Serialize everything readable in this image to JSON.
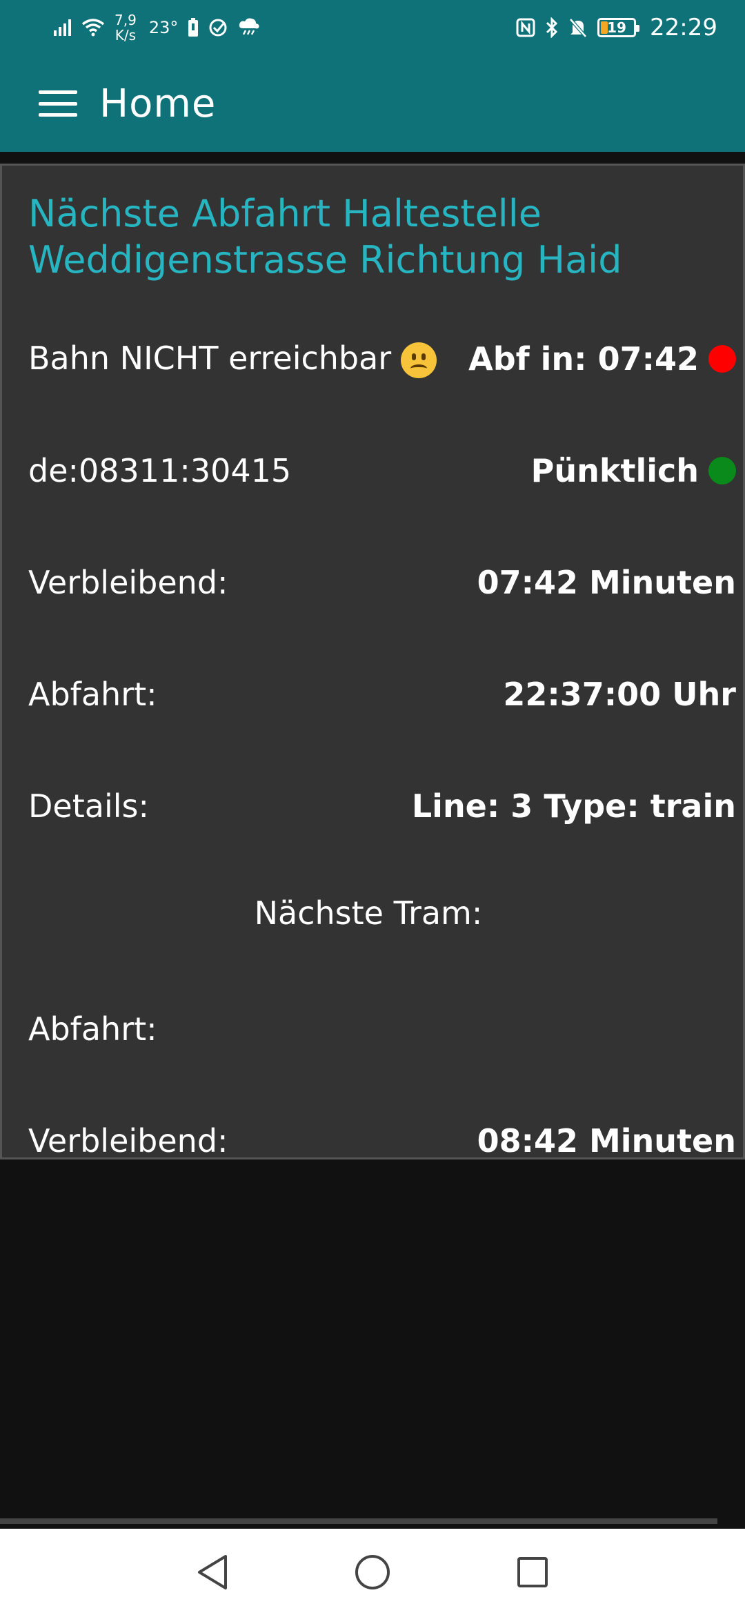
{
  "status_bar": {
    "speed_value": "7,9",
    "speed_unit": "K/s",
    "temperature": "23°",
    "battery_level": "19",
    "time": "22:29"
  },
  "app_bar": {
    "title": "Home",
    "menu_icon": "hamburger-menu-icon"
  },
  "card": {
    "title": "Nächste Abfahrt Haltestelle Weddigenstrasse Richtung Haid",
    "rows": [
      {
        "label": "Bahn NICHT erreichbar",
        "value": "Abf in: 07:42",
        "indicator_color": "#ff0000"
      },
      {
        "label": "de:08311:30415",
        "value": "Pünktlich",
        "indicator_color": "#0a8a1a"
      },
      {
        "label": "Verbleibend:",
        "value": "07:42 Minuten"
      },
      {
        "label": "Abfahrt:",
        "value": "22:37:00 Uhr"
      },
      {
        "label": "Details:",
        "value": "Line: 3 Type: train"
      },
      {
        "label": "Nächste Tram:"
      },
      {
        "label": "Abfahrt:",
        "value": ""
      },
      {
        "label": "Verbleibend:",
        "value": "08:42 Minuten"
      }
    ]
  },
  "colors": {
    "accent": "#0e7278",
    "title_text": "#26b5c1",
    "card_bg": "#333333",
    "page_bg": "#111111"
  }
}
